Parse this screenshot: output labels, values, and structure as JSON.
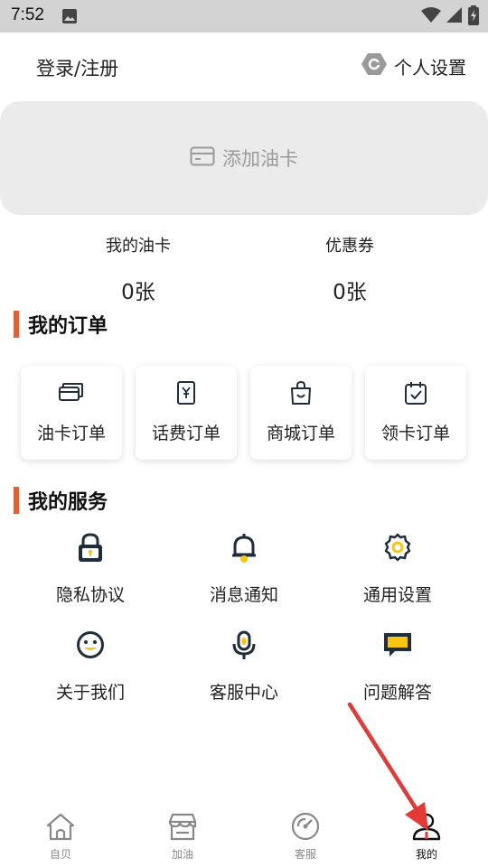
{
  "status_bar": {
    "time": "7:52"
  },
  "header": {
    "login_label": "登录/注册",
    "settings_label": "个人设置"
  },
  "card": {
    "add_label": "添加油卡"
  },
  "stats": [
    {
      "label": "我的油卡",
      "value": "0张"
    },
    {
      "label": "优惠券",
      "value": "0张"
    }
  ],
  "orders": {
    "title": "我的订单",
    "items": [
      {
        "label": "油卡订单",
        "icon": "card-stack-icon"
      },
      {
        "label": "话费订单",
        "icon": "yuan-receipt-icon"
      },
      {
        "label": "商城订单",
        "icon": "shopping-bag-icon"
      },
      {
        "label": "领卡订单",
        "icon": "calendar-check-icon"
      }
    ]
  },
  "services": {
    "title": "我的服务",
    "items": [
      {
        "label": "隐私协议",
        "icon": "lock-icon"
      },
      {
        "label": "消息通知",
        "icon": "bell-icon"
      },
      {
        "label": "通用设置",
        "icon": "gear-icon"
      },
      {
        "label": "关于我们",
        "icon": "smiley-icon"
      },
      {
        "label": "客服中心",
        "icon": "microphone-icon"
      },
      {
        "label": "问题解答",
        "icon": "chat-bubble-icon"
      }
    ]
  },
  "bottom_nav": [
    {
      "label": "自贝",
      "icon": "home-icon"
    },
    {
      "label": "加油",
      "icon": "store-icon"
    },
    {
      "label": "客服",
      "icon": "gauge-icon"
    },
    {
      "label": "我的",
      "icon": "user-icon"
    }
  ],
  "colors": {
    "accent": "#f05a28",
    "icon_yellow": "#f8c60e",
    "icon_dark": "#1f2d3d",
    "annotation_arrow": "#e53935"
  }
}
